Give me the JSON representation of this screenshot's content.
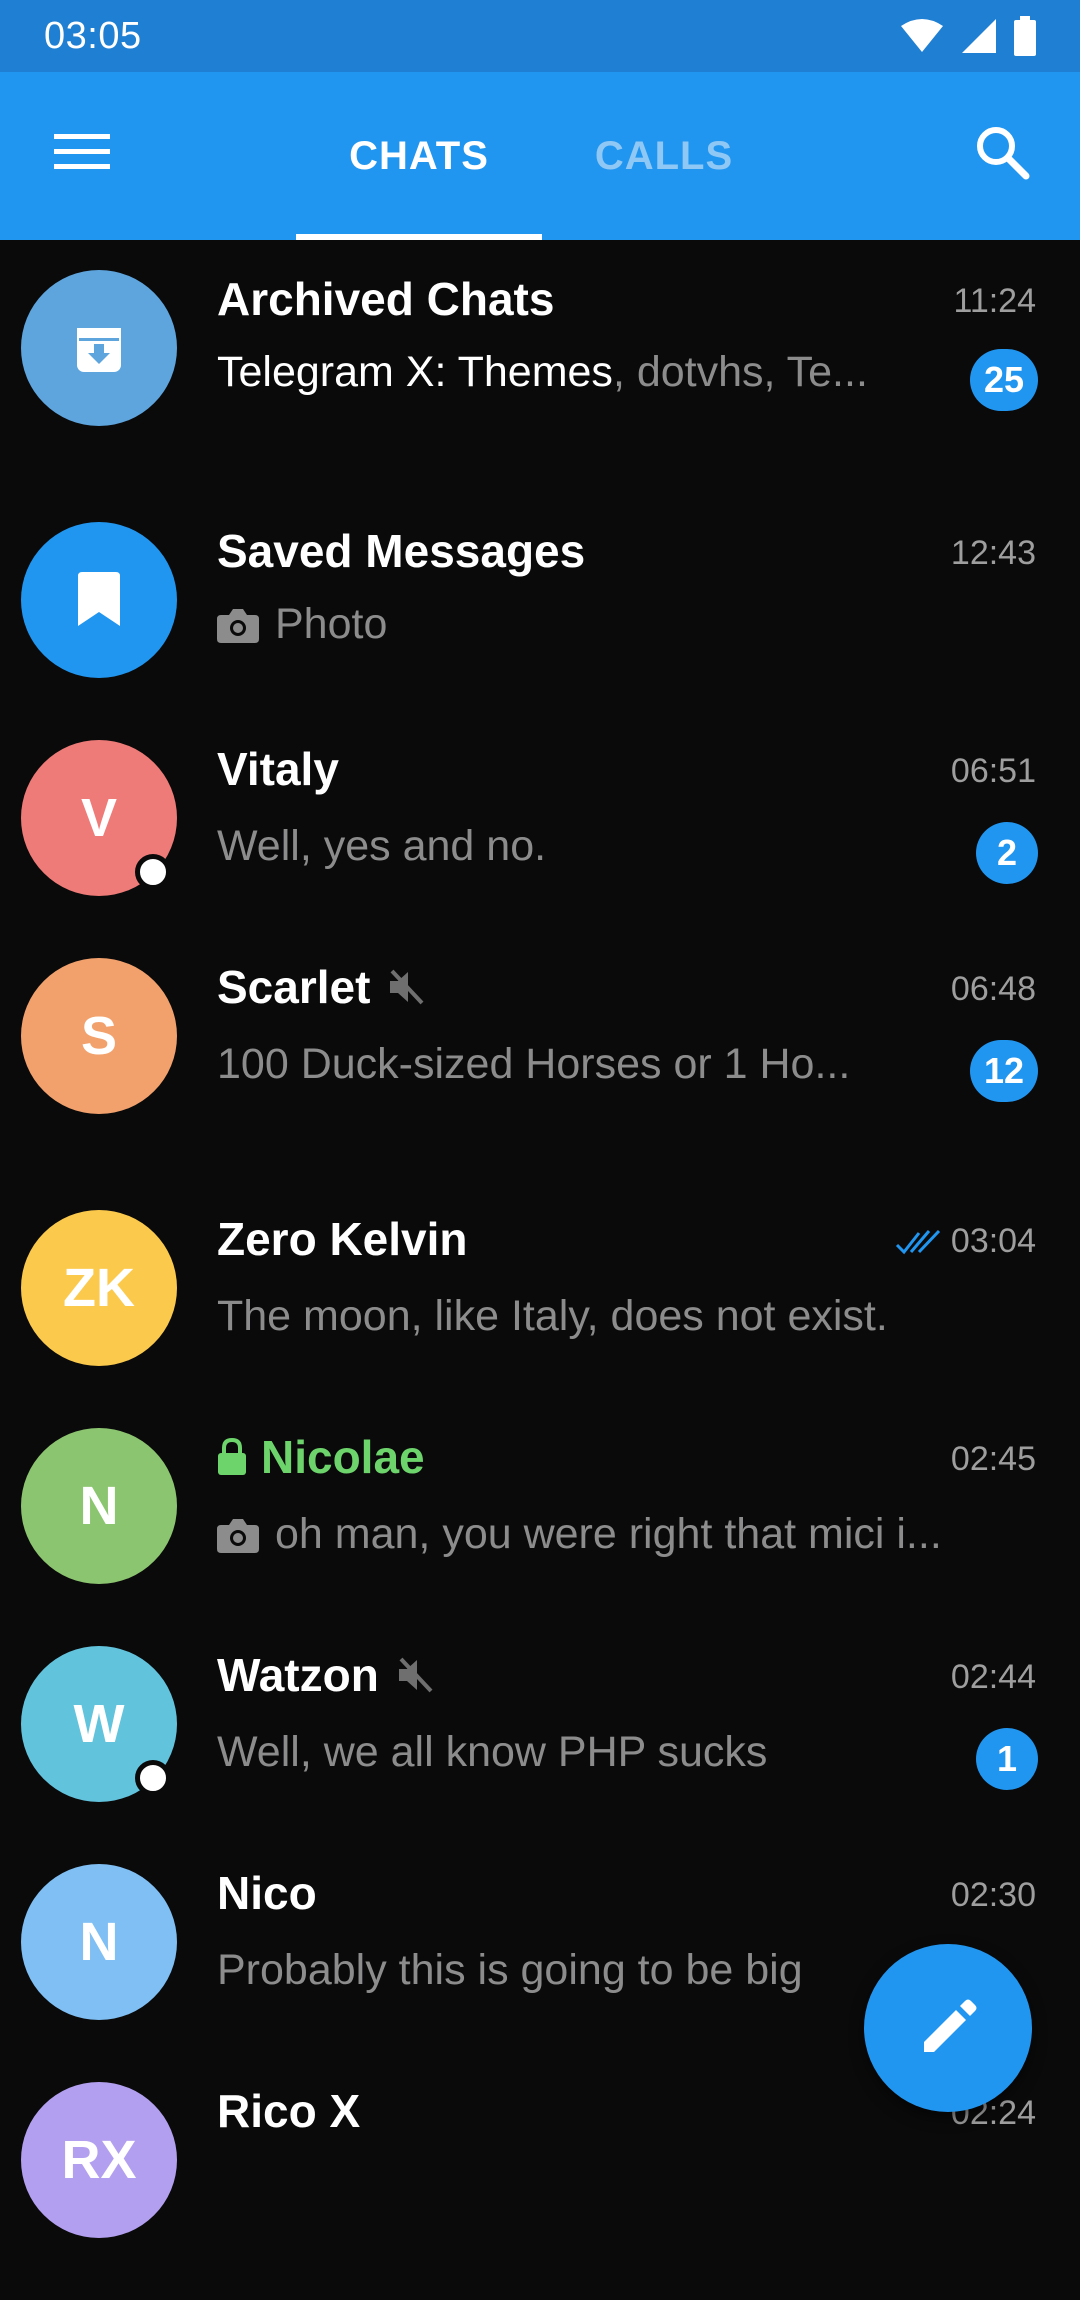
{
  "status_bar": {
    "time": "03:05",
    "icons": [
      "wifi-icon",
      "signal-icon",
      "battery-icon"
    ]
  },
  "app_bar": {
    "tabs": [
      {
        "label": "CHATS",
        "active": true
      },
      {
        "label": "CALLS",
        "active": false
      }
    ],
    "icons": [
      "menu-icon",
      "search-icon"
    ]
  },
  "colors": {
    "app_bar": "#2196f0",
    "status_bar": "#1f7fd2",
    "background": "#0a0a0b",
    "badge": "#2196f0",
    "secret_chat": "#6dd46b"
  },
  "chats": [
    {
      "name": "Archived Chats",
      "time": "11:24",
      "preview_strong": "Telegram X: Themes",
      "preview": ", dotvhs, Te...",
      "badge": "25",
      "avatar_icon": "archive-icon",
      "avatar_color": "#5ea5de"
    },
    {
      "name": "Saved Messages",
      "time": "12:43",
      "preview": "Photo",
      "preview_icon": "camera-icon",
      "avatar_icon": "bookmark-icon",
      "avatar_color": "#2196f0"
    },
    {
      "name": "Vitaly",
      "time": "06:51",
      "preview": "Well, yes and no.",
      "badge": "2",
      "initials": "V",
      "avatar_color": "#ef7b78",
      "online": true
    },
    {
      "name": "Scarlet",
      "time": "06:48",
      "preview": "100 Duck-sized Horses or 1 Ho...",
      "badge": "12",
      "initials": "S",
      "avatar_color": "#f2a16c",
      "muted": true
    },
    {
      "name": "Zero Kelvin",
      "time": "03:04",
      "preview": "The moon, like Italy, does not exist.",
      "initials": "ZK",
      "avatar_color": "#fbc94c",
      "read_status": "double-check-icon"
    },
    {
      "name": "Nicolae",
      "time": "02:45",
      "preview": "oh man, you were right that mici i...",
      "preview_icon": "camera-icon",
      "initials": "N",
      "avatar_color": "#8cc56f",
      "secret": true
    },
    {
      "name": "Watzon",
      "time": "02:44",
      "preview": "Well, we all know PHP sucks",
      "badge": "1",
      "initials": "W",
      "avatar_color": "#62c3dd",
      "muted": true,
      "online": true
    },
    {
      "name": "Nico",
      "time": "02:30",
      "preview": "Probably this is going to be big",
      "initials": "N",
      "avatar_color": "#7fbff3"
    },
    {
      "name": "Rico X",
      "time": "02:24",
      "initials": "RX",
      "avatar_color": "#b39ff0"
    }
  ],
  "fab": {
    "icon": "pencil-icon"
  }
}
